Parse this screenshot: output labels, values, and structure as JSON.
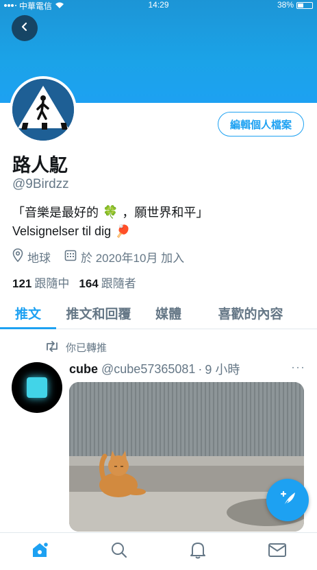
{
  "status_bar": {
    "carrier": "中華電信",
    "time": "14:29",
    "battery_label": "38%",
    "battery_level": 0.38
  },
  "profile": {
    "display_name": "路人鳦",
    "handle": "@9Birdzz",
    "edit_button": "編輯個人檔案",
    "bio_line1_before": "「音樂是最好的",
    "bio_line1_emoji": "🍀",
    "bio_line1_after": "，願世界和平」",
    "bio_line2_text": "Velsignelser til dig",
    "bio_line2_emoji": "🏓",
    "location": "地球",
    "joined": "於 2020年10月 加入",
    "following_count": "121",
    "following_label": "跟隨中",
    "followers_count": "164",
    "followers_label": "跟隨者"
  },
  "tabs": [
    {
      "label": "推文",
      "active": true
    },
    {
      "label": "推文和回覆",
      "active": false
    },
    {
      "label": "媒體",
      "active": false
    },
    {
      "label": "喜歡的內容",
      "active": false
    }
  ],
  "tweet": {
    "retweet_note": "你已轉推",
    "author_name": "cube",
    "author_handle": "@cube57365081",
    "separator": "·",
    "time_ago": "9 小時",
    "more": "···"
  },
  "colors": {
    "accent": "#1da1f2",
    "banner": "#1ba3e8",
    "muted": "#657786"
  },
  "icons": {
    "back": "back-arrow-icon",
    "compose": "compose-feather-icon",
    "nav": [
      "home-icon",
      "search-icon",
      "notifications-bell-icon",
      "messages-mail-icon"
    ]
  }
}
